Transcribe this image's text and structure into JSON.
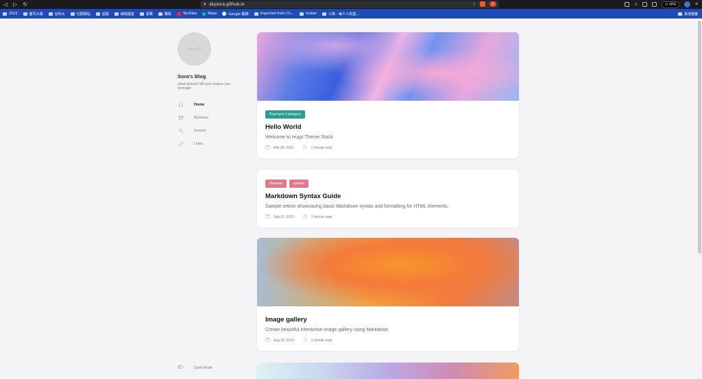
{
  "browser": {
    "url": "skysora.github.io",
    "vpn_label": "⊙ VPN",
    "brave_badge": "2",
    "bookmarks": [
      {
        "label": "2022",
        "kind": "folder"
      },
      {
        "label": "慶早大書",
        "kind": "folder"
      },
      {
        "label": "台科大",
        "kind": "folder"
      },
      {
        "label": "社群網站",
        "kind": "folder"
      },
      {
        "label": "認識",
        "kind": "folder"
      },
      {
        "label": "線頭講堂",
        "kind": "folder"
      },
      {
        "label": "素覽",
        "kind": "folder"
      },
      {
        "label": "購買",
        "kind": "folder"
      },
      {
        "label": "YouTube",
        "kind": "yt"
      },
      {
        "label": "Maps",
        "kind": "pin"
      },
      {
        "label": "Google 翻譯",
        "kind": "gg"
      },
      {
        "label": "Imported from Ch...",
        "kind": "folder"
      },
      {
        "label": "vtuber",
        "kind": "folder"
      },
      {
        "label": "斗魚 - 每个人的直...",
        "kind": "folder"
      }
    ],
    "bookmarks_other": "其他書籤"
  },
  "sidebar": {
    "avatar_text": "Sora 150",
    "site_name": "Sora's Blog",
    "site_desc": "what doesn't kill you makes you stronger",
    "menu": [
      {
        "label": "Home",
        "icon": "home-icon",
        "active": true
      },
      {
        "label": "Archives",
        "icon": "archive-icon",
        "active": false
      },
      {
        "label": "Search",
        "icon": "search-icon",
        "active": false
      },
      {
        "label": "Links",
        "icon": "link-icon",
        "active": false
      }
    ],
    "dark_mode_label": "Dark Mode"
  },
  "posts": [
    {
      "title": "Hello World",
      "subtitle": "Welcome to Hugo Theme Stack",
      "date": "Mar 06, 2022",
      "read_time": "1 minute read",
      "tags": [
        {
          "label": "Example Category",
          "color": "#2a9d8f"
        }
      ]
    },
    {
      "title": "Markdown Syntax Guide",
      "subtitle": "Sample article showcasing basic Markdown syntax and formatting for HTML elements.",
      "date": "Sep 07, 2023",
      "read_time": "3 minute read",
      "tags": [
        {
          "label": "themes",
          "color": "#e07a8a"
        },
        {
          "label": "syntax",
          "color": "#e07a8a"
        }
      ]
    },
    {
      "title": "Image gallery",
      "subtitle": "Create beautiful interactive image gallery using Markdown",
      "date": "Aug 26, 2023",
      "read_time": "1 minute read",
      "tags": []
    }
  ]
}
